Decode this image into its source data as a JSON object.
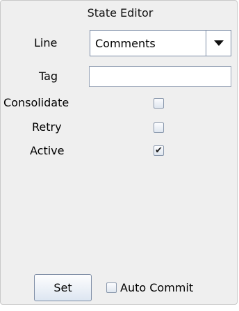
{
  "window": {
    "title": "State Editor"
  },
  "form": {
    "line": {
      "label": "Line",
      "selected_value": "Comments",
      "arrow_icon": "chevron-down-icon"
    },
    "tag": {
      "label": "Tag",
      "value": "",
      "placeholder": ""
    },
    "consolidate": {
      "label": "Consolidate",
      "checked": false
    },
    "retry": {
      "label": "Retry",
      "checked": false
    },
    "active": {
      "label": "Active",
      "checked": true,
      "check_glyph": "✔"
    }
  },
  "footer": {
    "set_label": "Set",
    "auto_commit": {
      "label": "Auto Commit",
      "checked": false
    }
  },
  "colors": {
    "panel_bg": "#efefef",
    "control_border": "#7c8ca6"
  }
}
